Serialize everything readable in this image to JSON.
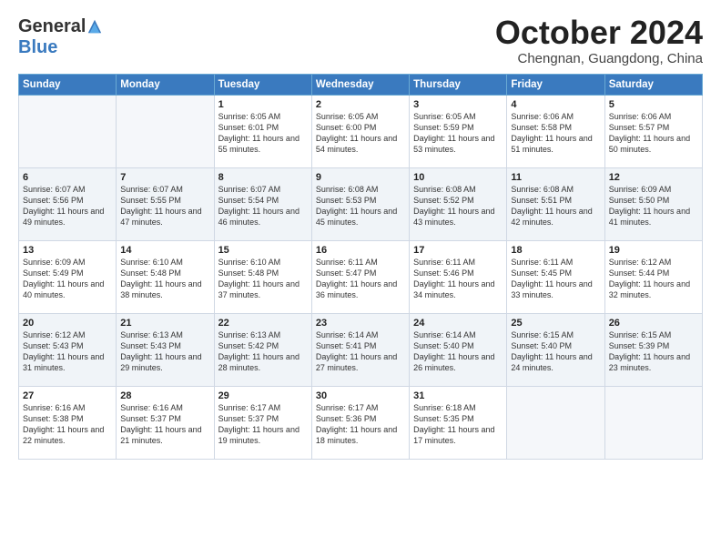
{
  "header": {
    "logo_general": "General",
    "logo_blue": "Blue",
    "month_title": "October 2024",
    "location": "Chengnan, Guangdong, China"
  },
  "weekdays": [
    "Sunday",
    "Monday",
    "Tuesday",
    "Wednesday",
    "Thursday",
    "Friday",
    "Saturday"
  ],
  "weeks": [
    [
      {
        "day": "",
        "info": ""
      },
      {
        "day": "",
        "info": ""
      },
      {
        "day": "1",
        "info": "Sunrise: 6:05 AM\nSunset: 6:01 PM\nDaylight: 11 hours and 55 minutes."
      },
      {
        "day": "2",
        "info": "Sunrise: 6:05 AM\nSunset: 6:00 PM\nDaylight: 11 hours and 54 minutes."
      },
      {
        "day": "3",
        "info": "Sunrise: 6:05 AM\nSunset: 5:59 PM\nDaylight: 11 hours and 53 minutes."
      },
      {
        "day": "4",
        "info": "Sunrise: 6:06 AM\nSunset: 5:58 PM\nDaylight: 11 hours and 51 minutes."
      },
      {
        "day": "5",
        "info": "Sunrise: 6:06 AM\nSunset: 5:57 PM\nDaylight: 11 hours and 50 minutes."
      }
    ],
    [
      {
        "day": "6",
        "info": "Sunrise: 6:07 AM\nSunset: 5:56 PM\nDaylight: 11 hours and 49 minutes."
      },
      {
        "day": "7",
        "info": "Sunrise: 6:07 AM\nSunset: 5:55 PM\nDaylight: 11 hours and 47 minutes."
      },
      {
        "day": "8",
        "info": "Sunrise: 6:07 AM\nSunset: 5:54 PM\nDaylight: 11 hours and 46 minutes."
      },
      {
        "day": "9",
        "info": "Sunrise: 6:08 AM\nSunset: 5:53 PM\nDaylight: 11 hours and 45 minutes."
      },
      {
        "day": "10",
        "info": "Sunrise: 6:08 AM\nSunset: 5:52 PM\nDaylight: 11 hours and 43 minutes."
      },
      {
        "day": "11",
        "info": "Sunrise: 6:08 AM\nSunset: 5:51 PM\nDaylight: 11 hours and 42 minutes."
      },
      {
        "day": "12",
        "info": "Sunrise: 6:09 AM\nSunset: 5:50 PM\nDaylight: 11 hours and 41 minutes."
      }
    ],
    [
      {
        "day": "13",
        "info": "Sunrise: 6:09 AM\nSunset: 5:49 PM\nDaylight: 11 hours and 40 minutes."
      },
      {
        "day": "14",
        "info": "Sunrise: 6:10 AM\nSunset: 5:48 PM\nDaylight: 11 hours and 38 minutes."
      },
      {
        "day": "15",
        "info": "Sunrise: 6:10 AM\nSunset: 5:48 PM\nDaylight: 11 hours and 37 minutes."
      },
      {
        "day": "16",
        "info": "Sunrise: 6:11 AM\nSunset: 5:47 PM\nDaylight: 11 hours and 36 minutes."
      },
      {
        "day": "17",
        "info": "Sunrise: 6:11 AM\nSunset: 5:46 PM\nDaylight: 11 hours and 34 minutes."
      },
      {
        "day": "18",
        "info": "Sunrise: 6:11 AM\nSunset: 5:45 PM\nDaylight: 11 hours and 33 minutes."
      },
      {
        "day": "19",
        "info": "Sunrise: 6:12 AM\nSunset: 5:44 PM\nDaylight: 11 hours and 32 minutes."
      }
    ],
    [
      {
        "day": "20",
        "info": "Sunrise: 6:12 AM\nSunset: 5:43 PM\nDaylight: 11 hours and 31 minutes."
      },
      {
        "day": "21",
        "info": "Sunrise: 6:13 AM\nSunset: 5:43 PM\nDaylight: 11 hours and 29 minutes."
      },
      {
        "day": "22",
        "info": "Sunrise: 6:13 AM\nSunset: 5:42 PM\nDaylight: 11 hours and 28 minutes."
      },
      {
        "day": "23",
        "info": "Sunrise: 6:14 AM\nSunset: 5:41 PM\nDaylight: 11 hours and 27 minutes."
      },
      {
        "day": "24",
        "info": "Sunrise: 6:14 AM\nSunset: 5:40 PM\nDaylight: 11 hours and 26 minutes."
      },
      {
        "day": "25",
        "info": "Sunrise: 6:15 AM\nSunset: 5:40 PM\nDaylight: 11 hours and 24 minutes."
      },
      {
        "day": "26",
        "info": "Sunrise: 6:15 AM\nSunset: 5:39 PM\nDaylight: 11 hours and 23 minutes."
      }
    ],
    [
      {
        "day": "27",
        "info": "Sunrise: 6:16 AM\nSunset: 5:38 PM\nDaylight: 11 hours and 22 minutes."
      },
      {
        "day": "28",
        "info": "Sunrise: 6:16 AM\nSunset: 5:37 PM\nDaylight: 11 hours and 21 minutes."
      },
      {
        "day": "29",
        "info": "Sunrise: 6:17 AM\nSunset: 5:37 PM\nDaylight: 11 hours and 19 minutes."
      },
      {
        "day": "30",
        "info": "Sunrise: 6:17 AM\nSunset: 5:36 PM\nDaylight: 11 hours and 18 minutes."
      },
      {
        "day": "31",
        "info": "Sunrise: 6:18 AM\nSunset: 5:35 PM\nDaylight: 11 hours and 17 minutes."
      },
      {
        "day": "",
        "info": ""
      },
      {
        "day": "",
        "info": ""
      }
    ]
  ]
}
